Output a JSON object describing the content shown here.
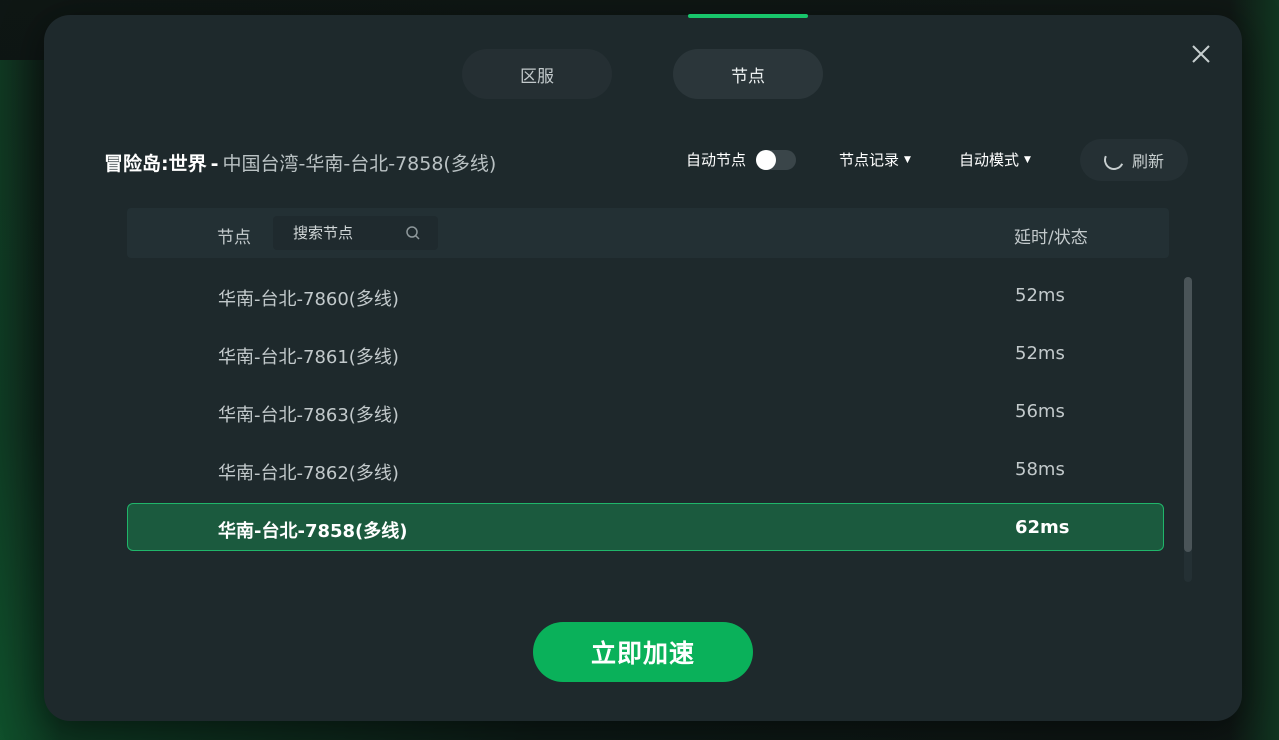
{
  "tabs": {
    "region": "区服",
    "node": "节点"
  },
  "title": {
    "game": "冒险岛:世界",
    "separator": "-",
    "current_node": "中国台湾-华南-台北-7858(多线)"
  },
  "controls": {
    "auto_node_label": "自动节点",
    "auto_node_enabled": false,
    "node_record_label": "节点记录",
    "auto_mode_label": "自动模式",
    "refresh_label": "刷新"
  },
  "list": {
    "header_node": "节点",
    "search_placeholder": "搜索节点",
    "header_latency": "延时/状态",
    "rows": [
      {
        "name": "华南-台北-7860(多线)",
        "latency": "52ms",
        "selected": false
      },
      {
        "name": "华南-台北-7861(多线)",
        "latency": "52ms",
        "selected": false
      },
      {
        "name": "华南-台北-7863(多线)",
        "latency": "56ms",
        "selected": false
      },
      {
        "name": "华南-台北-7862(多线)",
        "latency": "58ms",
        "selected": false
      },
      {
        "name": "华南-台北-7858(多线)",
        "latency": "62ms",
        "selected": true
      }
    ]
  },
  "accelerate_label": "立即加速",
  "colors": {
    "accent": "#0ab15a",
    "dialog_bg": "#1e292c",
    "selected_row_bg": "#1b5a3e",
    "selected_row_border": "#20b56a"
  },
  "icons": {
    "close": "close-icon",
    "search": "search-icon",
    "refresh": "refresh-icon",
    "caret": "caret-down-icon"
  }
}
